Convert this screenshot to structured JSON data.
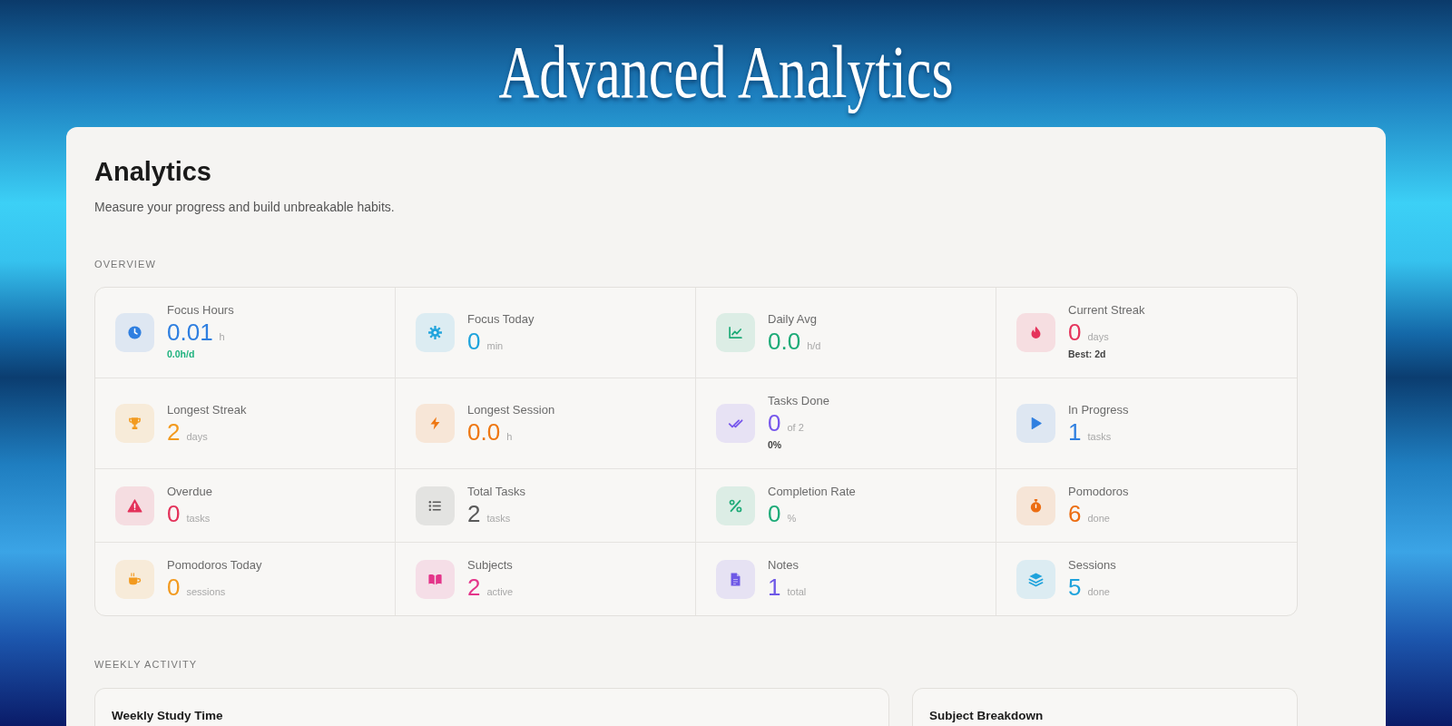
{
  "banner": {
    "title": "Advanced Analytics"
  },
  "page": {
    "title": "Analytics",
    "subtitle": "Measure your progress and build unbreakable habits."
  },
  "overview": {
    "heading": "OVERVIEW",
    "stats": [
      {
        "label": "Focus Hours",
        "value": "0.01",
        "unit": "h",
        "note": {
          "text": "0.0h/d",
          "kind": "trend"
        },
        "color": "#2f7fe0"
      },
      {
        "label": "Focus Today",
        "value": "0",
        "unit": "min",
        "color": "#1fa3dc"
      },
      {
        "label": "Daily Avg",
        "value": "0.0",
        "unit": "h/d",
        "color": "#1eab78"
      },
      {
        "label": "Current Streak",
        "value": "0",
        "unit": "days",
        "note": {
          "text": "Best: 2d",
          "kind": "info"
        },
        "color": "#e5345c"
      },
      {
        "label": "Longest Streak",
        "value": "2",
        "unit": "days",
        "color": "#f29a1f"
      },
      {
        "label": "Longest Session",
        "value": "0.0",
        "unit": "h",
        "color": "#ee7712"
      },
      {
        "label": "Tasks Done",
        "value": "0",
        "unit": "of 2",
        "note": {
          "text": "0%",
          "kind": "info"
        },
        "color": "#7757ec"
      },
      {
        "label": "In Progress",
        "value": "1",
        "unit": "tasks",
        "color": "#2f7fe0"
      },
      {
        "label": "Overdue",
        "value": "0",
        "unit": "tasks",
        "color": "#e3325a"
      },
      {
        "label": "Total Tasks",
        "value": "2",
        "unit": "tasks",
        "color": "#5a5a5a"
      },
      {
        "label": "Completion Rate",
        "value": "0",
        "unit": "%",
        "color": "#1eab78"
      },
      {
        "label": "Pomodoros",
        "value": "6",
        "unit": "done",
        "color": "#ec6d12"
      },
      {
        "label": "Pomodoros Today",
        "value": "0",
        "unit": "sessions",
        "color": "#f29a1f"
      },
      {
        "label": "Subjects",
        "value": "2",
        "unit": "active",
        "color": "#e4358a"
      },
      {
        "label": "Notes",
        "value": "1",
        "unit": "total",
        "color": "#6e58e6"
      },
      {
        "label": "Sessions",
        "value": "5",
        "unit": "done",
        "color": "#1fa3dc"
      }
    ]
  },
  "weekly_activity": {
    "heading": "WEEKLY ACTIVITY",
    "panels": [
      {
        "title": "Weekly Study Time"
      },
      {
        "title": "Subject Breakdown"
      }
    ]
  }
}
